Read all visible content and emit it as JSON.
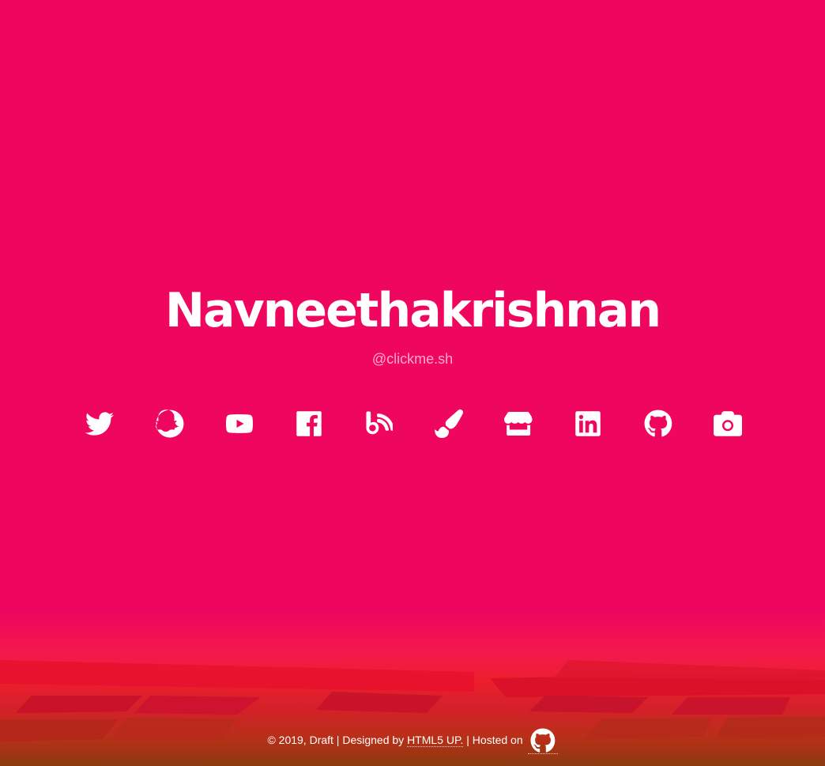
{
  "header": {
    "title": "Navneethakrishnan",
    "subtitle": "@clickme.sh"
  },
  "social_icons": [
    {
      "name": "twitter-icon"
    },
    {
      "name": "snapchat-icon"
    },
    {
      "name": "youtube-icon"
    },
    {
      "name": "facebook-icon"
    },
    {
      "name": "blog-icon"
    },
    {
      "name": "paint-brush-icon"
    },
    {
      "name": "store-icon"
    },
    {
      "name": "linkedin-icon"
    },
    {
      "name": "github-icon"
    },
    {
      "name": "camera-icon"
    }
  ],
  "footer": {
    "copyright": "© 2019, Draft | Designed by ",
    "designer_link": "HTML5 UP.",
    "hosted_text": " | Hosted on ",
    "host_icon": "github-icon"
  },
  "colors": {
    "background": "#ef075f",
    "text": "#ffffff"
  }
}
